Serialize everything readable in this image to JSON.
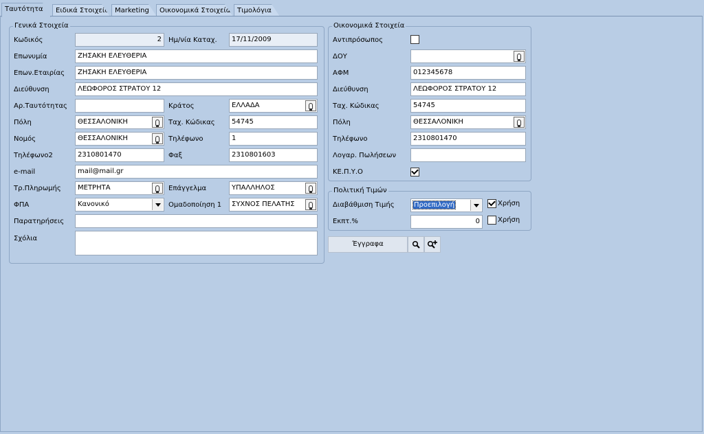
{
  "tabs": [
    "Ταυτότητα",
    "Ειδικά Στοιχεία",
    "Marketing",
    "Οικονομικά Στοιχεία",
    "Τιμολόγια"
  ],
  "general": {
    "title": "Γενικά Στοιχεία",
    "code_label": "Κωδικός",
    "code": "2",
    "regdate_label": "Ημ/νία Καταχ.",
    "regdate": "17/11/2009",
    "name_label": "Επωνυμία",
    "name": "ΖΗΣΑΚΗ ΕΛΕΥΘΕΡΙΑ",
    "company_label": "Επων.Εταιρίας",
    "company": "ΖΗΣΑΚΗ ΕΛΕΥΘΕΡΙΑ",
    "address_label": "Διεύθυνση",
    "address": "ΛΕΩΦΟΡΟΣ ΣΤΡΑΤΟΥ 12",
    "idnum_label": "Αρ.Ταυτότητας",
    "idnum": "",
    "country_label": "Κράτος",
    "country": "ΕΛΛΑΔΑ",
    "city_label": "Πόλη",
    "city": "ΘΕΣΣΑΛΟΝΙΚΗ",
    "zip_label": "Ταχ. Κώδικας",
    "zip": "54745",
    "prefecture_label": "Νομός",
    "prefecture": "ΘΕΣΣΑΛΟΝΙΚΗ",
    "phone_label": "Τηλέφωνο",
    "phone": "1",
    "phone2_label": "Τηλέφωνο2",
    "phone2": "2310801470",
    "fax_label": "Φαξ",
    "fax": "2310801603",
    "email_label": "e-mail",
    "email": "mail@mail.gr",
    "payment_label": "Τρ.Πληρωμής",
    "payment": "ΜΕΤΡΗΤΑ",
    "profession_label": "Επάγγελμα",
    "profession": "ΥΠΑΛΛΗΛΟΣ",
    "vat_label": "ΦΠΑ",
    "vat": "Κανονικό",
    "group1_label": "Ομαδοποίηση 1",
    "group1": "ΣΥΧΝΟΣ ΠΕΛΑΤΗΣ",
    "notes_label": "Παρατηρήσεις",
    "notes": "",
    "comments_label": "Σχόλια",
    "comments": ""
  },
  "financial": {
    "title": "Οικονομικά Στοιχεία",
    "representative_label": "Αντιπρόσωπος",
    "representative": false,
    "doy_label": "ΔΟΥ",
    "doy": "",
    "afm_label": "ΑΦΜ",
    "afm": "012345678",
    "address_label": "Διεύθυνση",
    "address": "ΛΕΩΦΟΡΟΣ ΣΤΡΑΤΟΥ 12",
    "zip_label": "Ταχ. Κώδικας",
    "zip": "54745",
    "city_label": "Πόλη",
    "city": "ΘΕΣΣΑΛΟΝΙΚΗ",
    "phone_label": "Τηλέφωνο",
    "phone": "2310801470",
    "sales_account_label": "Λογαρ. Πωλήσεων",
    "sales_account": "",
    "kepyo_label": "ΚΕ.Π.Υ.Ο",
    "kepyo": true
  },
  "pricing": {
    "title": "Πολιτική Τιμών",
    "price_level_label": "Διαβάθμιση Τιμής",
    "price_level": "Προεπιλογή",
    "use_label": "Χρήση",
    "price_level_use": true,
    "discount_label": "Εκπτ.%",
    "discount": "0",
    "discount_use": false
  },
  "documents_button": "Έγγραφα",
  "icons": {
    "lookup": "lightbulb-icon",
    "search": "search-icon",
    "add_search": "search-add-icon",
    "dropdown": "chevron-down-icon"
  }
}
